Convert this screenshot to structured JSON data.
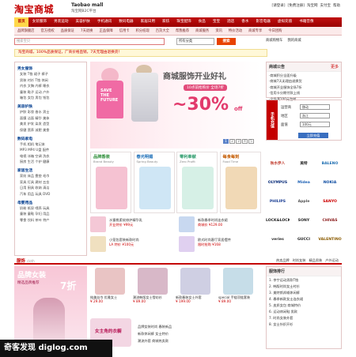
{
  "header": {
    "logo_cn": "淘宝商城",
    "logo_en": "Taobao mall",
    "logo_sub": "淘宝网B2C平台",
    "top_links": [
      "[请登录]",
      "[免费注册]",
      "淘宝网",
      "支付宝",
      "帮助"
    ]
  },
  "nav": {
    "items": [
      "首页",
      "女装服饰",
      "男装运动",
      "美容护肤",
      "手机通讯",
      "数码电器",
      "家居日用",
      "家纺",
      "珠宝配饰",
      "食品",
      "宝宝",
      "酒店",
      "香水",
      "影音电器",
      "虚拟充值",
      "书籍音像"
    ],
    "active_index": 0
  },
  "subnav": {
    "items": [
      "品牌旗舰店",
      "官方授权",
      "品质保证",
      "7天退换",
      "正品保障",
      "信用卡",
      "积分抵现",
      "百货大全",
      "帮我推荐",
      "商城服务",
      "资讯",
      "特价活动",
      "商城专享",
      "今日团购"
    ]
  },
  "search": {
    "placeholder": "搜索宝贝",
    "category": "所有分类",
    "button": "搜索",
    "right_links": [
      "商城购物车",
      "我的商城"
    ]
  },
  "promo_strip": "淘宝商城，100%品质保证，厂商价格直销，7天无理由退换货！",
  "left_categories": [
    {
      "title": "男女服饰",
      "lines": [
        "女装 T恤 裙子 裤子",
        "男装 衬衫 T恤 休闲",
        "内衣 文胸 内裤 睡衣",
        "童装 鞋子 运动 户外",
        "箱包 女包 男包 钱包"
      ]
    },
    {
      "title": "美容护肤",
      "lines": [
        "护肤 彩妆 香水 男士",
        "面膜 洁面 精华 美体",
        "美发 护发 染发 造型",
        "保健 营养 减肥 美食"
      ]
    },
    {
      "title": "数码家电",
      "lines": [
        "手机 相机 笔记本",
        "MP3 MP4 U盘 配件",
        "电视 冰箱 空调 洗衣",
        "厨房 生活 个护 健康"
      ]
    },
    {
      "title": "家居生活",
      "lines": [
        "家纺 床品 靠垫 毛巾",
        "家具 灯具 建材 五金",
        "日用 厨具 收纳 清洁",
        "汽车 用品 玩具 DVD"
      ]
    },
    {
      "title": "母婴用品",
      "lines": [
        "奶粉 纸尿 喂养 玩具",
        "童装 童鞋 孕妇 用品",
        "零食 饮料 茶叶 特产"
      ]
    }
  ],
  "banner": {
    "title": "商城服饰开业好礼",
    "subtitle": "10点前抢购价 全场7折",
    "discount": "~30%",
    "off": "off",
    "shirt_text": "SAVE THE FUTURE",
    "pages": [
      "1",
      "2",
      "3",
      "4",
      "5"
    ],
    "active_page": 0
  },
  "tiles": [
    {
      "title": "品牌香装",
      "sub": "Brand Beauty",
      "color": "#2f8f3a",
      "art": "#f5c2d2"
    },
    {
      "title": "春光明媚",
      "sub": "Spring Beauty",
      "color": "#1d6fb8",
      "art": "#cfe6f5"
    },
    {
      "title": "零利奉献",
      "sub": "Zero Profit",
      "color": "#2a9a6a",
      "art": "#d6f0e6"
    },
    {
      "title": "每食每刻",
      "sub": "Food Time",
      "color": "#c45a00",
      "art": "#f1d9b6"
    }
  ],
  "promos": [
    {
      "text": "水蜜桃柔软修护精华乳",
      "price": "开业特价 ¥99元",
      "art": "#f4c8d6"
    },
    {
      "text": "新款春季时尚连衣裙",
      "price": "商城价 ¥129.00",
      "art": "#c8d8f0"
    },
    {
      "text": "小笼包套装新款时尚",
      "price": "LA 特价 ¥100元",
      "art": "#f0e0c0"
    },
    {
      "text": "欧式时尚客厅家居摆件",
      "price": "限时抢购 ¥168",
      "art": "#e0d0f0"
    }
  ],
  "announce": {
    "title": "商城公告",
    "more": "更多",
    "lines": [
      "·商城积分全面升级",
      "·商城7天无理由退换货",
      "·商城开业服饰全场7折",
      "·信用卡分期付款上线",
      "·全场满100元包邮"
    ]
  },
  "phone_recharge": {
    "tag": "手机充值",
    "fields": [
      {
        "label": "运营商",
        "value": "移动"
      },
      {
        "label": "地区",
        "value": "浙江"
      },
      {
        "label": "面值",
        "value": "100元"
      }
    ],
    "button": "立即充值"
  },
  "brand_logos": [
    "秋水伊人",
    "美特",
    "BALENO",
    "OLYMPUS",
    "Midea",
    "NOKIA",
    "PHILIPS",
    "Apple",
    "SANYO",
    "LOCK&LOCK",
    "SONY",
    "CHIVAS",
    "veries",
    "GUCCI",
    "VALENTINO"
  ],
  "sec2": {
    "title": "服饰",
    "title_en": "cloth",
    "links": [
      "热卖品牌",
      "时尚女装",
      "精品男装",
      "户外运动"
    ],
    "left_title": "品牌女装",
    "left_sub": "精选品牌推荐",
    "left_num": "7折",
    "products": [
      {
        "name": "纯美丝巾 优雅女士",
        "price": "¥ 29.00",
        "art": "#e9c4c4"
      },
      {
        "name": "潮流韩版女士雪纺衫",
        "price": "¥ 89.00",
        "art": "#d8b8c8"
      },
      {
        "name": "新款春装女士外套",
        "price": "¥ 199.00",
        "art": "#cfcfe3"
      },
      {
        "name": "special 手链项链套装",
        "price": "¥ 89.00",
        "art": "#c6dde8"
      }
    ],
    "sale_title": "女主角的衣橱",
    "mid_lines": [
      "品牌女装时尚 春装新品",
      "新款休闲裤 女士特价",
      "潮流外套 商城热卖款"
    ],
    "rank_title": "服饰排行",
    "rank": [
      "1. 李宁运动男款T恤",
      "2. 韩版时尚女士衬衫",
      "3. 美特斯邦威休闲裤",
      "4. 春季新款女士连衣裙",
      "5. 皮质女包 商城特价",
      "6. 运动休闲鞋 男款",
      "7. 时尚女装外套",
      "8. 女士针织开衫"
    ]
  },
  "watermark": "奇客发现 diglog.com"
}
